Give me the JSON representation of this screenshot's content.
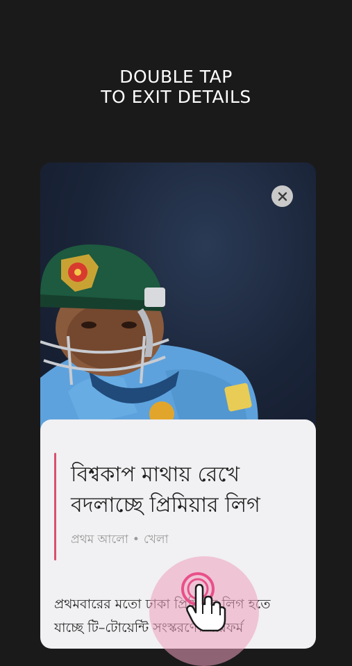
{
  "hint": {
    "line1": "DOUBLE TAP",
    "line2": "TO EXIT DETAILS"
  },
  "card": {
    "image_description_icon": "cricketer-photo",
    "close_icon": "close-icon",
    "headline_line1": "বিশ্বকাপ মাথায় রেখে",
    "headline_line2": "বদলাচ্ছে প্রিমিয়ার লিগ",
    "source": "প্রথম আলো",
    "separator": "•",
    "category": "খেলা",
    "body_line1": "প্রথমবারের মতো ঢাকা প্রিমিয়ার লিগ হতে",
    "body_line2": "যাচ্ছে টি–টোয়েন্টি সংস্করণে। পারফর্ম"
  },
  "colors": {
    "background": "#1b1a1b",
    "accent": "#d94f6e",
    "sheet": "#f1f0f2",
    "tap_highlight": "#e8508a"
  }
}
